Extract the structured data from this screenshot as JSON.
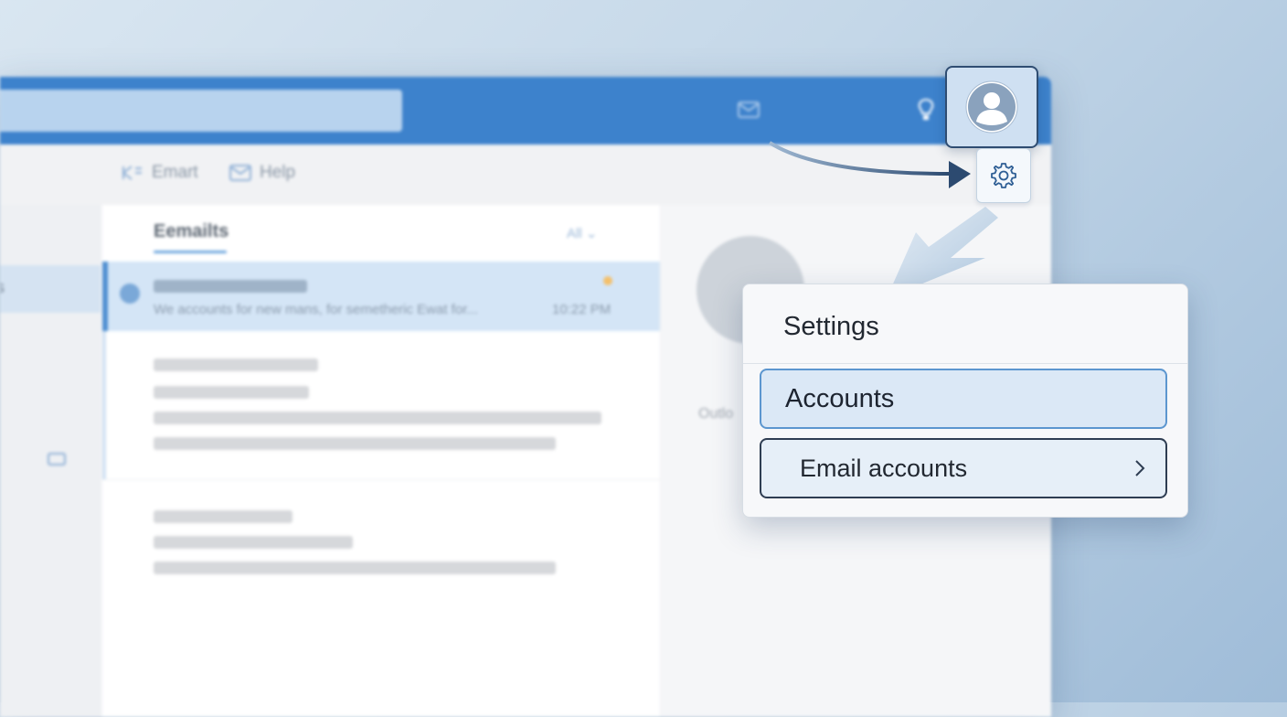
{
  "command_bar": {
    "items": [
      {
        "label": "Emart",
        "icon": "new-email-icon"
      },
      {
        "label": "Help",
        "icon": "mail-icon"
      }
    ]
  },
  "email_list": {
    "title": "Eemailts",
    "filter_label": "All",
    "selected_email": {
      "preview": "We accounts for new mans, for semetheric Ewat for...",
      "time": "10:22 PM"
    }
  },
  "reading_pane": {
    "label": "Outlo"
  },
  "settings_popup": {
    "title": "Settings",
    "items": [
      {
        "label": "Accounts"
      },
      {
        "label": "Email accounts"
      }
    ]
  },
  "icons": {
    "profile": "avatar-icon",
    "settings": "gear-icon",
    "submenu": "chevron-right-icon",
    "tips": "lightbulb-icon"
  },
  "colors": {
    "title_bar": "#3d82cc",
    "selection": "#d4e5f6",
    "accent_border": "#5c96cf",
    "dark_border": "#2f4d72"
  }
}
